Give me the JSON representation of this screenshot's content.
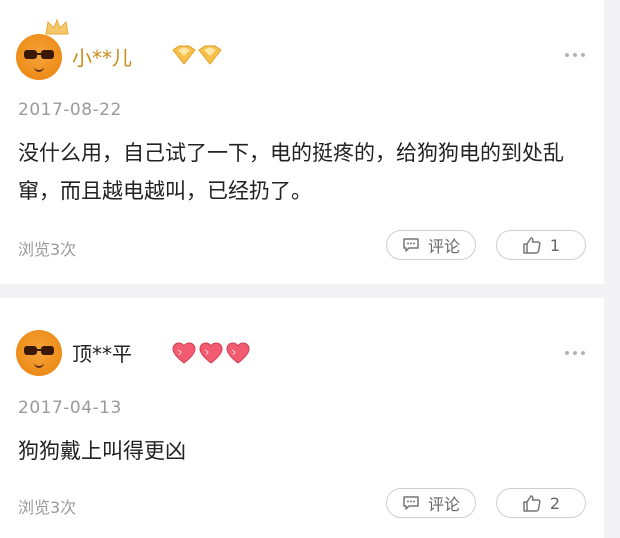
{
  "comments": [
    {
      "username": "小**儿",
      "date": "2017-08-22",
      "content": "没什么用，自己试了一下，电的挺疼的，给狗狗电的到处乱窜，而且越电越叫，已经扔了。",
      "views": "浏览3次",
      "comment_label": "评论",
      "like_count": "1",
      "badge_icon": "gold-diamond-icon",
      "accent": "#f4b23c"
    },
    {
      "username": "顶**平",
      "date": "2017-04-13",
      "content": "狗狗戴上叫得更凶",
      "views": "浏览3次",
      "comment_label": "评论",
      "like_count": "2",
      "badge_icon": "red-heart-icon",
      "accent": "#f05a6e"
    }
  ]
}
